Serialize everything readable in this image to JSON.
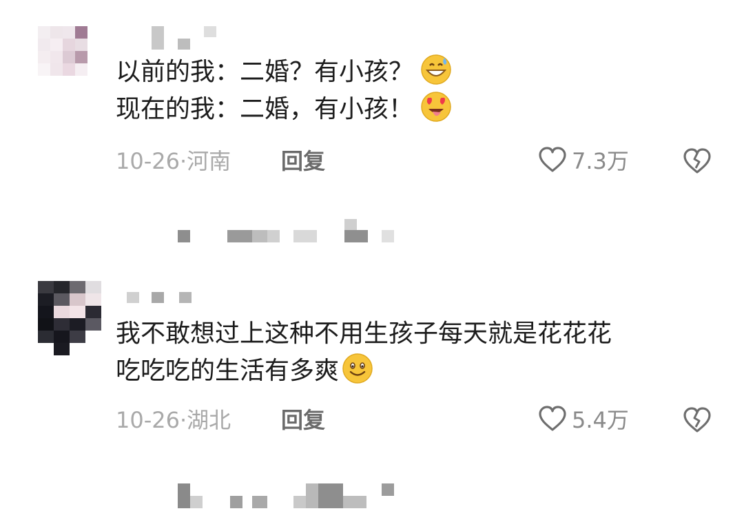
{
  "comments": [
    {
      "lines": [
        "以前的我：二婚？有小孩？",
        "现在的我：二婚，有小孩！"
      ],
      "emojis": [
        "grinning-sweat-emoji",
        "heart-eyes-tongue-emoji"
      ],
      "date": "10-26",
      "location": "河南",
      "reply_label": "回复",
      "like_count": "7.3万"
    },
    {
      "lines": [
        "我不敢想过上这种不用生孩子每天就是花花花",
        "吃吃吃的生活有多爽"
      ],
      "emojis": [
        "smiling-face-emoji"
      ],
      "date": "10-26",
      "location": "湖北",
      "reply_label": "回复",
      "like_count": "5.4万"
    }
  ],
  "icons": {
    "like": "heart-outline-icon",
    "dislike": "broken-heart-icon"
  },
  "colors": {
    "text": "#1c1c1c",
    "meta": "#a9a9a9",
    "reply": "#6a6a6a",
    "count": "#8a8a8a"
  }
}
